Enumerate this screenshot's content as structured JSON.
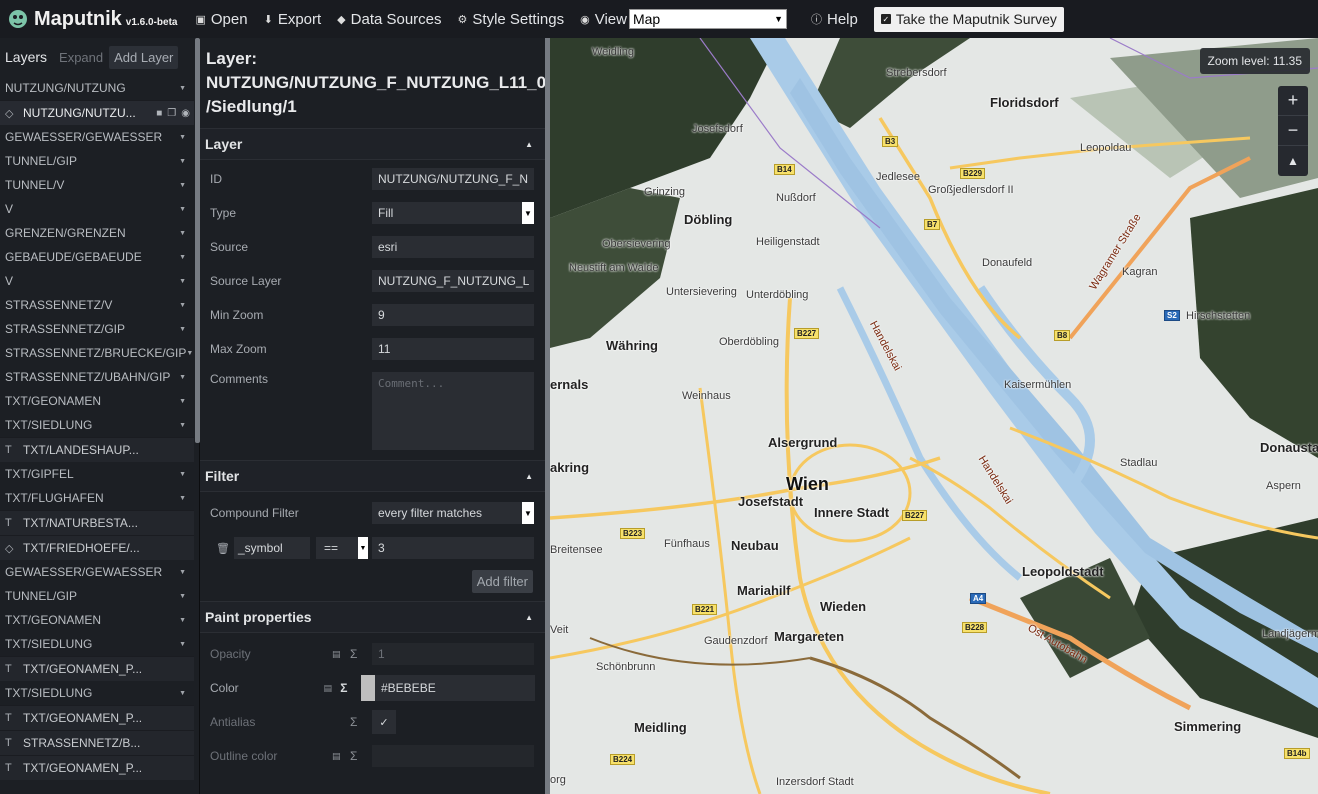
{
  "app": {
    "name": "Maputnik",
    "version": "v1.6.0-beta"
  },
  "toolbar": {
    "open": "Open",
    "export": "Export",
    "data_sources": "Data Sources",
    "style_settings": "Style Settings",
    "view": "View",
    "view_value": "Map",
    "help": "Help",
    "survey": "Take the Maputnik Survey"
  },
  "layers_panel": {
    "title": "Layers",
    "expand": "Expand",
    "add_layer": "Add Layer",
    "rows": [
      {
        "kind": "group",
        "label": "NUTZUNG/NUTZUNG"
      },
      {
        "kind": "item",
        "icon": "fill-icon",
        "label": "NUTZUNG/NUTZU...",
        "selected": true
      },
      {
        "kind": "group",
        "label": "GEWAESSER/GEWAESSER"
      },
      {
        "kind": "group",
        "label": "TUNNEL/GIP"
      },
      {
        "kind": "group",
        "label": "TUNNEL/V"
      },
      {
        "kind": "group",
        "label": "V"
      },
      {
        "kind": "group",
        "label": "GRENZEN/GRENZEN"
      },
      {
        "kind": "group",
        "label": "GEBAEUDE/GEBAEUDE"
      },
      {
        "kind": "group",
        "label": "V"
      },
      {
        "kind": "group",
        "label": "STRASSENNETZ/V"
      },
      {
        "kind": "group",
        "label": "STRASSENNETZ/GIP"
      },
      {
        "kind": "group",
        "label": "STRASSENNETZ/BRUECKE/GIP"
      },
      {
        "kind": "group",
        "label": "STRASSENNETZ/UBAHN/GIP"
      },
      {
        "kind": "group",
        "label": "TXT/GEONAMEN"
      },
      {
        "kind": "group",
        "label": "TXT/SIEDLUNG"
      },
      {
        "kind": "item",
        "icon": "symbol-icon",
        "label": "TXT/LANDESHAUP..."
      },
      {
        "kind": "group",
        "label": "TXT/GIPFEL"
      },
      {
        "kind": "group",
        "label": "TXT/FLUGHAFEN"
      },
      {
        "kind": "item",
        "icon": "symbol-icon",
        "label": "TXT/NATURBESTA..."
      },
      {
        "kind": "item",
        "icon": "fill-icon",
        "label": "TXT/FRIEDHOEFE/..."
      },
      {
        "kind": "group",
        "label": "GEWAESSER/GEWAESSER"
      },
      {
        "kind": "group",
        "label": "TUNNEL/GIP"
      },
      {
        "kind": "group",
        "label": "TXT/GEONAMEN"
      },
      {
        "kind": "group",
        "label": "TXT/SIEDLUNG"
      },
      {
        "kind": "item",
        "icon": "symbol-icon",
        "label": "TXT/GEONAMEN_P..."
      },
      {
        "kind": "group",
        "label": "TXT/SIEDLUNG"
      },
      {
        "kind": "item",
        "icon": "symbol-icon",
        "label": "TXT/GEONAMEN_P..."
      },
      {
        "kind": "item",
        "icon": "symbol-icon",
        "label": "STRASSENNETZ/B..."
      },
      {
        "kind": "item",
        "icon": "symbol-icon",
        "label": "TXT/GEONAMEN_P..."
      }
    ]
  },
  "editor": {
    "title_line1": "Layer:",
    "title_line2": "NUTZUNG/NUTZUNG_F_NUTZUNG_L11_0",
    "title_line3": "/Siedlung/1",
    "layer_section": "Layer",
    "fields": {
      "id_label": "ID",
      "id_value": "NUTZUNG/NUTZUNG_F_N",
      "type_label": "Type",
      "type_value": "Fill",
      "source_label": "Source",
      "source_value": "esri",
      "source_layer_label": "Source Layer",
      "source_layer_value": "NUTZUNG_F_NUTZUNG_L",
      "min_zoom_label": "Min Zoom",
      "min_zoom_value": "9",
      "max_zoom_label": "Max Zoom",
      "max_zoom_value": "11",
      "comments_label": "Comments",
      "comments_placeholder": "Comment..."
    },
    "filter_section": "Filter",
    "filter": {
      "compound_label": "Compound Filter",
      "compound_value": "every filter matches",
      "key": "_symbol",
      "operator": "==",
      "value": "3",
      "add_filter": "Add filter"
    },
    "paint_section": "Paint properties",
    "paint": {
      "opacity_label": "Opacity",
      "opacity_value": "1",
      "color_label": "Color",
      "color_value": "#BEBEBE",
      "antialias_label": "Antialias",
      "outline_label": "Outline color"
    }
  },
  "map": {
    "zoom_level": "Zoom level: 11.35",
    "labels": {
      "wien": "Wien",
      "floridsdorf": "Floridsdorf",
      "doebling": "Döbling",
      "waehring": "Währing",
      "alsergrund": "Alsergrund",
      "josefstadt": "Josefstadt",
      "innere_stadt": "Innere Stadt",
      "neubau": "Neubau",
      "mariahilf": "Mariahilf",
      "wieden": "Wieden",
      "margareten": "Margareten",
      "leopoldstadt": "Leopoldstadt",
      "meidling": "Meidling",
      "simmering": "Simmering",
      "donaustadt": "Donausta",
      "weidling": "Weidling",
      "strebersdorf": "Strebersdorf",
      "josefsdorf": "Josefsdorf",
      "leopoldau": "Leopoldau",
      "jedlesee": "Jedlesee",
      "grossjedlersdorf": "Großjedlersdorf II",
      "grinzing": "Grinzing",
      "nussdorf": "Nußdorf",
      "heiligenstadt": "Heiligenstadt",
      "obersievering": "Obersievering",
      "neustift": "Neustift am Walde",
      "untersievering": "Untersievering",
      "unterdoebling": "Unterdöbling",
      "oberdoebling": "Oberdöbling",
      "donaufeld": "Donaufeld",
      "kagran": "Kagran",
      "hirschstetten": "Hirschstetten",
      "kaisermuehlen": "Kaisermühlen",
      "weinhaus": "Weinhaus",
      "hernals": "ernals",
      "ottakring": "akring",
      "breitensee": "Breitensee",
      "fuenfhaus": "Fünfhaus",
      "stadlau": "Stadlau",
      "aspern": "Aspern",
      "gaudenzdorf": "Gaudenzdorf",
      "schoenbrunn": "Schönbrunn",
      "landjaegermeister": "Landjägerm",
      "inzersdorf": "Inzersdorf Stadt",
      "veit": "Veit",
      "org": "org",
      "handelskai_1": "Handelskai",
      "handelskai_2": "Handelskai",
      "wagramer": "Wagramer Straße",
      "ost_autobahn": "Ost Autobahn"
    },
    "shields": [
      "B14",
      "B3",
      "B229",
      "B7",
      "B227",
      "B8",
      "S2",
      "B227",
      "B223",
      "B221",
      "A4",
      "B228",
      "B224",
      "B14b"
    ]
  },
  "colors": {
    "accent_river": "#a9cbe8",
    "road_major": "#f6c85f",
    "road_motorway": "#f0a35a",
    "vegetation": "#2f3d2c",
    "urban": "#e3e6e4"
  }
}
